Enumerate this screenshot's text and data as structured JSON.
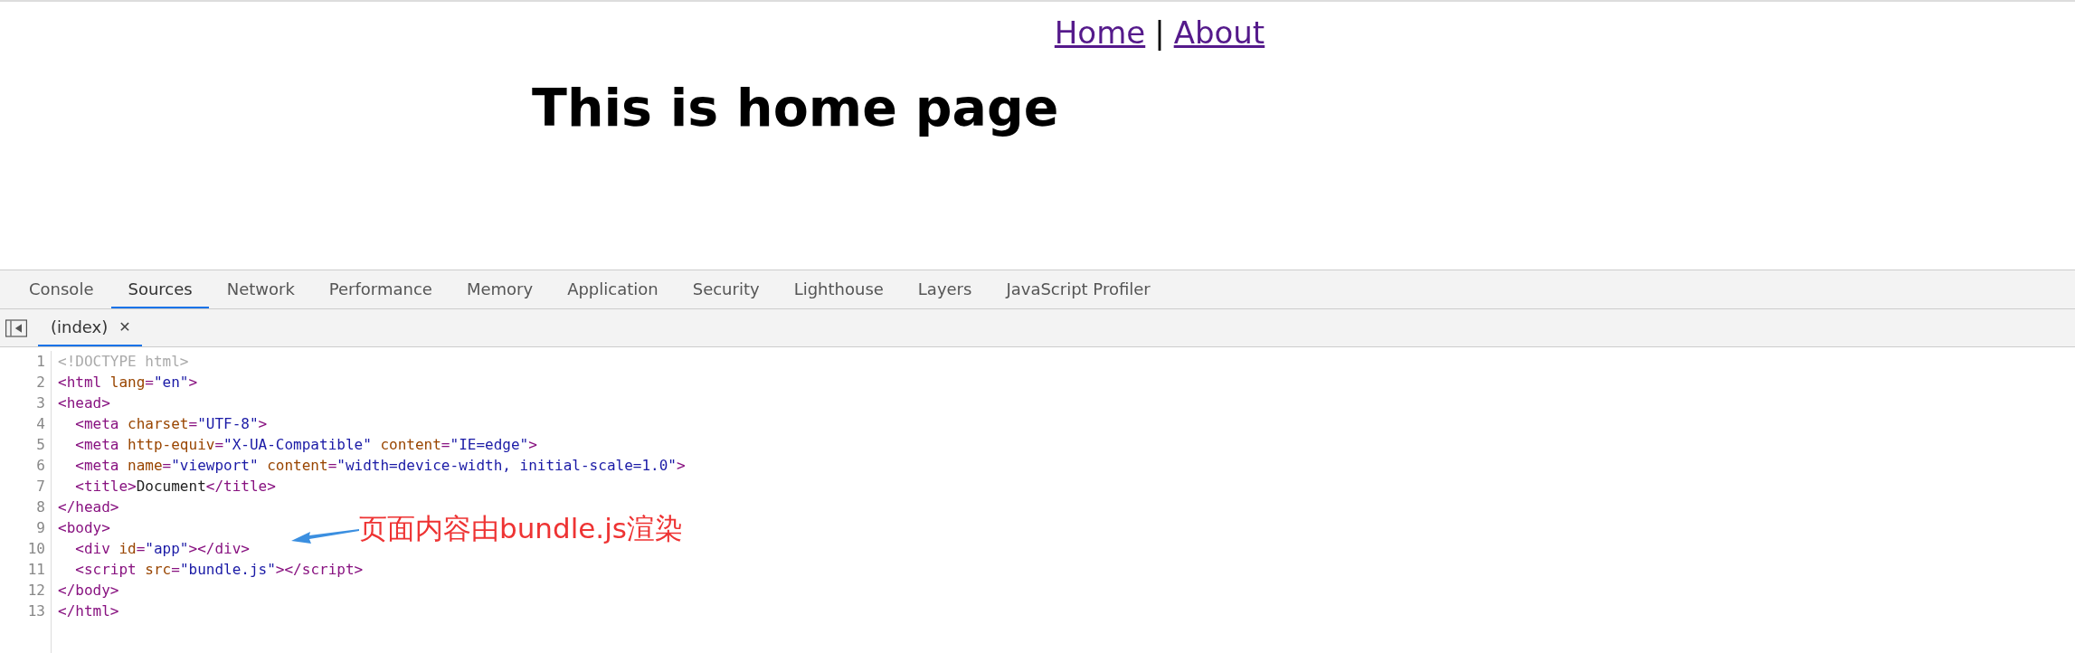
{
  "page": {
    "nav": [
      {
        "label": "Home"
      },
      {
        "label": "About"
      }
    ],
    "separator": "|",
    "heading": "This is home page"
  },
  "devtools": {
    "tabs": [
      {
        "label": "Console",
        "selected": false
      },
      {
        "label": "Sources",
        "selected": true
      },
      {
        "label": "Network",
        "selected": false
      },
      {
        "label": "Performance",
        "selected": false
      },
      {
        "label": "Memory",
        "selected": false
      },
      {
        "label": "Application",
        "selected": false
      },
      {
        "label": "Security",
        "selected": false
      },
      {
        "label": "Lighthouse",
        "selected": false
      },
      {
        "label": "Layers",
        "selected": false
      },
      {
        "label": "JavaScript Profiler",
        "selected": false
      }
    ],
    "file_tabs": [
      {
        "label": "(index)",
        "close": "✕",
        "selected": true
      }
    ],
    "code": [
      {
        "number": "1",
        "indented": false,
        "tokens": [
          {
            "kind": "doctype",
            "text": "<!DOCTYPE html>"
          }
        ]
      },
      {
        "number": "2",
        "indented": false,
        "tokens": [
          {
            "kind": "tag",
            "text": "<html"
          },
          {
            "kind": "attr",
            "text": "lang"
          },
          {
            "kind": "tag",
            "text": "="
          },
          {
            "kind": "value",
            "text": "\"en\""
          },
          {
            "kind": "tag",
            "text": ">"
          }
        ]
      },
      {
        "number": "3",
        "indented": false,
        "tokens": [
          {
            "kind": "tag",
            "text": "<head>"
          }
        ]
      },
      {
        "number": "4",
        "indented": true,
        "tokens": [
          {
            "kind": "tag",
            "text": "<meta"
          },
          {
            "kind": "attr",
            "text": "charset"
          },
          {
            "kind": "tag",
            "text": "="
          },
          {
            "kind": "value",
            "text": "\"UTF-8\""
          },
          {
            "kind": "tag",
            "text": ">"
          }
        ]
      },
      {
        "number": "5",
        "indented": true,
        "tokens": [
          {
            "kind": "tag",
            "text": "<meta"
          },
          {
            "kind": "attr",
            "text": "http-equiv"
          },
          {
            "kind": "tag",
            "text": "="
          },
          {
            "kind": "value",
            "text": "\"X-UA-Compatible\""
          },
          {
            "kind": "attr",
            "text": "content"
          },
          {
            "kind": "tag",
            "text": "="
          },
          {
            "kind": "value",
            "text": "\"IE=edge\""
          },
          {
            "kind": "tag",
            "text": ">"
          }
        ]
      },
      {
        "number": "6",
        "indented": true,
        "tokens": [
          {
            "kind": "tag",
            "text": "<meta"
          },
          {
            "kind": "attr",
            "text": "name"
          },
          {
            "kind": "tag",
            "text": "="
          },
          {
            "kind": "value",
            "text": "\"viewport\""
          },
          {
            "kind": "attr",
            "text": "content"
          },
          {
            "kind": "tag",
            "text": "="
          },
          {
            "kind": "value",
            "text": "\"width=device-width, initial-scale=1.0\""
          },
          {
            "kind": "tag",
            "text": ">"
          }
        ]
      },
      {
        "number": "7",
        "indented": true,
        "tokens": [
          {
            "kind": "tag",
            "text": "<title>"
          },
          {
            "kind": "text",
            "text": "Document"
          },
          {
            "kind": "tag",
            "text": "</title>"
          }
        ]
      },
      {
        "number": "8",
        "indented": false,
        "tokens": [
          {
            "kind": "tag",
            "text": "</head>"
          }
        ]
      },
      {
        "number": "9",
        "indented": false,
        "tokens": [
          {
            "kind": "tag",
            "text": "<body>"
          }
        ]
      },
      {
        "number": "10",
        "indented": true,
        "tokens": [
          {
            "kind": "tag",
            "text": "<div"
          },
          {
            "kind": "attr",
            "text": "id"
          },
          {
            "kind": "tag",
            "text": "="
          },
          {
            "kind": "value",
            "text": "\"app\""
          },
          {
            "kind": "tag",
            "text": "></div>"
          }
        ]
      },
      {
        "number": "11",
        "indented": true,
        "tokens": [
          {
            "kind": "tag",
            "text": "<script"
          },
          {
            "kind": "attr",
            "text": "src"
          },
          {
            "kind": "tag",
            "text": "="
          },
          {
            "kind": "value",
            "text": "\"bundle.js\""
          },
          {
            "kind": "tag",
            "text": "></script>"
          }
        ]
      },
      {
        "number": "12",
        "indented": false,
        "tokens": [
          {
            "kind": "tag",
            "text": "</body>"
          }
        ]
      },
      {
        "number": "13",
        "indented": false,
        "tokens": [
          {
            "kind": "tag",
            "text": "</html>"
          }
        ]
      }
    ],
    "annotation": {
      "text": "页面内容由bundle.js渲染"
    }
  }
}
